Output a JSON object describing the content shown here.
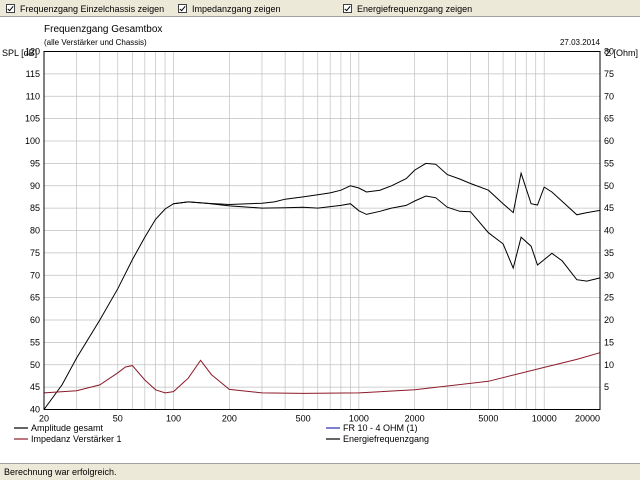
{
  "toolbar": {
    "checkboxes": [
      {
        "label": "Frequenzgang Einzelchassis zeigen",
        "checked": true
      },
      {
        "label": "Impedanzgang zeigen",
        "checked": true
      },
      {
        "label": "Energiefrequenzgang zeigen",
        "checked": true
      }
    ]
  },
  "status": "Berechnung war erfolgreich.",
  "colors": {
    "amplitude": "#000000",
    "impedance": "#8b1a2a",
    "fr": "#2a2ab0",
    "energy": "#000000",
    "grid": "#c0c0c0"
  },
  "chart_data": {
    "type": "line",
    "title": "Frequenzgang Gesamtbox",
    "subtitle": "(alle Verstärker und Chassis)",
    "date": "27.03.2014",
    "ylabel": "SPL [dB]",
    "y2label": "Z [Ohm]",
    "xscale": "log",
    "xlim": [
      20,
      20000
    ],
    "ylim": [
      40,
      120
    ],
    "y2lim": [
      0,
      80
    ],
    "x_ticks": [
      "20",
      "50",
      "100",
      "200",
      "500",
      "1000",
      "2000",
      "5000",
      "10000",
      "20000"
    ],
    "y_ticks": [
      40,
      45,
      50,
      55,
      60,
      65,
      70,
      75,
      80,
      85,
      90,
      95,
      100,
      105,
      110,
      115,
      120
    ],
    "y2_ticks": [
      5,
      10,
      15,
      20,
      25,
      30,
      35,
      40,
      45,
      50,
      55,
      60,
      65,
      70,
      75,
      80
    ],
    "grid": true,
    "legend": [
      {
        "label": "Amplitude gesamt",
        "series": "amplitude"
      },
      {
        "label": "Impedanz Verstärker 1",
        "series": "impedance"
      },
      {
        "label": "FR 10 - 4 OHM (1)",
        "series": "fr"
      },
      {
        "label": "Energiefrequenzgang",
        "series": "energy"
      }
    ],
    "series": [
      {
        "name": "Amplitude gesamt",
        "axis": "left",
        "x": [
          20,
          25,
          30,
          40,
          50,
          60,
          70,
          80,
          90,
          100,
          120,
          150,
          200,
          300,
          400,
          500,
          600,
          800,
          900,
          1000,
          1100,
          1300,
          1500,
          1800,
          2000,
          2300,
          2600,
          3000,
          3500,
          4000,
          5000,
          6000,
          6800,
          7500,
          8500,
          9200,
          10000,
          11000,
          12500,
          15000,
          17000,
          20000
        ],
        "y": [
          38.6,
          45.5,
          51.5,
          60,
          67,
          73.5,
          78.5,
          82.5,
          84.8,
          86,
          86.4,
          86.1,
          85.5,
          85,
          85.1,
          85.2,
          85,
          85.6,
          86,
          84.4,
          83.6,
          84.3,
          85,
          85.6,
          86.6,
          87.7,
          87.3,
          85.2,
          84.3,
          84.2,
          79.5,
          77,
          71.6,
          78.5,
          76.5,
          72.3,
          73.5,
          74.9,
          73.2,
          69,
          68.7,
          69.4
        ]
      },
      {
        "name": "Impedanz Verstärker 1",
        "axis": "right",
        "x": [
          20,
          30,
          40,
          50,
          55,
          60,
          70,
          80,
          90,
          100,
          120,
          140,
          160,
          200,
          300,
          500,
          1000,
          2000,
          5000,
          10000,
          15000,
          20000
        ],
        "y": [
          3.7,
          4.2,
          5.5,
          8.2,
          9.5,
          9.8,
          6.6,
          4.4,
          3.7,
          4.0,
          7.0,
          11.0,
          7.8,
          4.5,
          3.7,
          3.6,
          3.7,
          4.4,
          6.3,
          9.4,
          11.2,
          12.7
        ]
      },
      {
        "name": "Energiefrequenzgang",
        "axis": "left",
        "x": [
          100,
          120,
          150,
          200,
          300,
          350,
          400,
          500,
          600,
          700,
          800,
          900,
          1000,
          1100,
          1300,
          1500,
          1800,
          2000,
          2300,
          2600,
          3000,
          3500,
          4000,
          5000,
          6000,
          6800,
          7500,
          8500,
          9200,
          10000,
          11000,
          12500,
          15000,
          17000,
          20000
        ],
        "y": [
          86,
          86.4,
          86.1,
          85.8,
          86.1,
          86.4,
          87,
          87.5,
          88,
          88.4,
          89,
          90,
          89.5,
          88.6,
          89,
          90,
          91.6,
          93.5,
          95,
          94.8,
          92.5,
          91.5,
          90.5,
          89,
          86,
          84,
          92.8,
          86,
          85.7,
          89.7,
          88.6,
          86.5,
          83.5,
          84,
          84.5
        ]
      }
    ]
  }
}
